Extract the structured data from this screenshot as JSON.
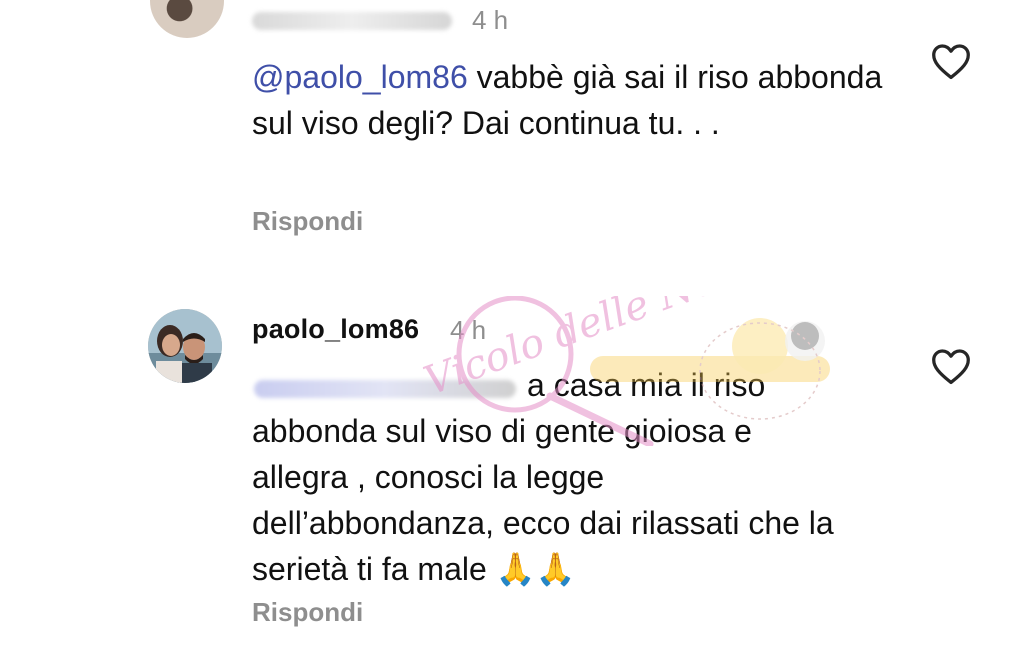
{
  "comments": [
    {
      "username": "",
      "time": "4 h",
      "mention": "@paolo_lom86",
      "text": " vabbè già sai il riso abbonda sul viso degli? Dai continua tu. . .",
      "reply_label": "Rispondi"
    },
    {
      "username": "paolo_lom86",
      "time": "4 h",
      "text_line1_end": "a casa mia il riso",
      "text_rest": "abbonda sul viso di gente gioiosa e allegra , conosci la legge dell’abbondanza, ecco dai rilassati che la serietà ti fa male 🙏🙏",
      "reply_label": "Rispondi"
    }
  ],
  "watermark": {
    "text": "Vicolo delle News"
  },
  "colors": {
    "mention": "#3f4fa8",
    "secondary_text": "#8e8e8e",
    "heart_outline": "#262626",
    "watermark_pink": "#e58fc8"
  },
  "icons": {
    "like": "heart-outline-icon"
  }
}
